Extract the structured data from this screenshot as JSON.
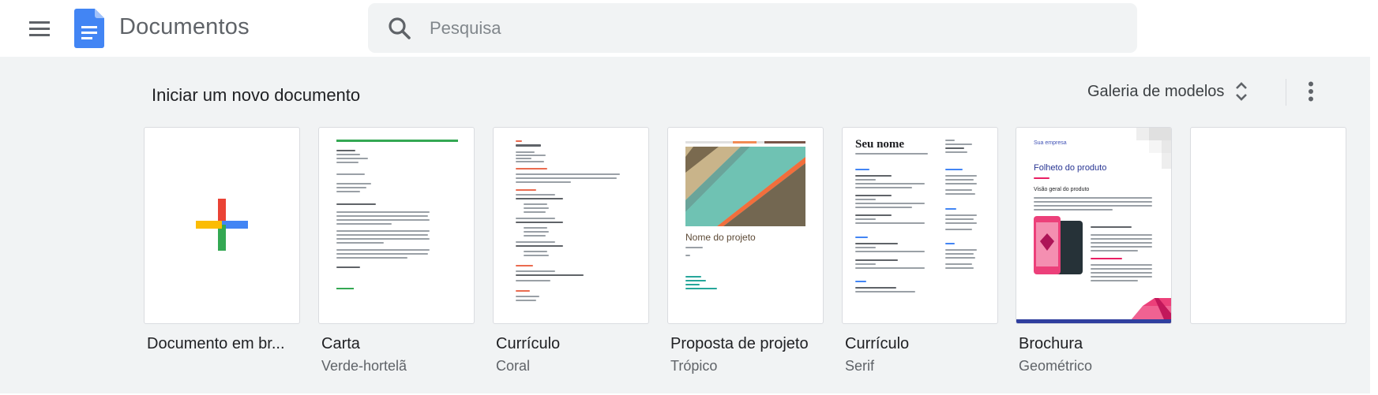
{
  "header": {
    "app_title": "Documentos",
    "search_placeholder": "Pesquisa"
  },
  "templates_section": {
    "title": "Iniciar um novo documento",
    "gallery_label": "Galeria de modelos",
    "items": [
      {
        "name": "Documento em br...",
        "subtitle": ""
      },
      {
        "name": "Carta",
        "subtitle": "Verde-hortelã"
      },
      {
        "name": "Currículo",
        "subtitle": "Coral"
      },
      {
        "name": "Proposta de projeto",
        "subtitle": "Trópico"
      },
      {
        "name": "Currículo",
        "subtitle": "Serif"
      },
      {
        "name": "Brochura",
        "subtitle": "Geométrico"
      }
    ]
  },
  "thumbnails": {
    "project_proposal_title": "Nome do projeto",
    "serif_resume_title": "Seu nome",
    "brochure_company": "Sua empresa",
    "brochure_title": "Folheto do produto",
    "brochure_heading": "Visão geral do produto"
  },
  "colors": {
    "docs_blue": "#4285f4",
    "google_red": "#ea4335",
    "google_yellow": "#fbbc04",
    "google_green": "#34a853"
  }
}
